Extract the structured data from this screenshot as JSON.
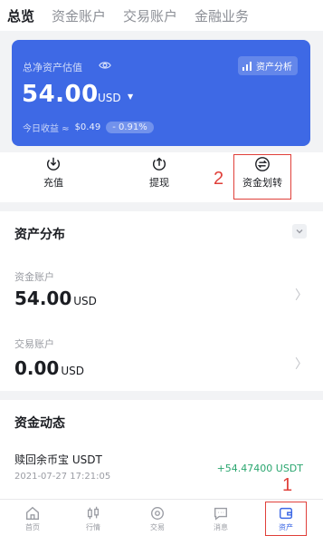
{
  "tabs": [
    {
      "label": "总览",
      "active": true
    },
    {
      "label": "资金账户",
      "active": false
    },
    {
      "label": "交易账户",
      "active": false
    },
    {
      "label": "金融业务",
      "active": false
    }
  ],
  "summary": {
    "label": "总净资产估值",
    "analysis_button": "资产分析",
    "balance": "54.00",
    "unit": "USD",
    "today_label": "今日收益 ≈",
    "today_value": "$0.49",
    "today_change": "- 0.91%"
  },
  "actions": [
    {
      "label": "充值",
      "icon": "deposit-icon"
    },
    {
      "label": "提现",
      "icon": "withdraw-icon"
    },
    {
      "label": "资金划转",
      "icon": "transfer-icon"
    }
  ],
  "annotations": {
    "step1": "1",
    "step2": "2"
  },
  "distribution": {
    "title": "资产分布",
    "accounts": [
      {
        "label": "资金账户",
        "value": "54.00",
        "unit": "USD"
      },
      {
        "label": "交易账户",
        "value": "0.00",
        "unit": "USD"
      }
    ]
  },
  "activity": {
    "title": "资金动态",
    "records": [
      {
        "title": "赎回余币宝 USDT",
        "time": "2021-07-27 17:21:05",
        "amount": "+54.47400 USDT"
      }
    ]
  },
  "nav": [
    {
      "label": "首页",
      "icon": "home-icon"
    },
    {
      "label": "行情",
      "icon": "market-icon"
    },
    {
      "label": "交易",
      "icon": "trade-icon"
    },
    {
      "label": "消息",
      "icon": "message-icon"
    },
    {
      "label": "资产",
      "icon": "wallet-icon",
      "active": true
    }
  ],
  "colors": {
    "accent": "#3e69e5",
    "annotation": "#e0403a",
    "positive": "#2aa66f"
  }
}
